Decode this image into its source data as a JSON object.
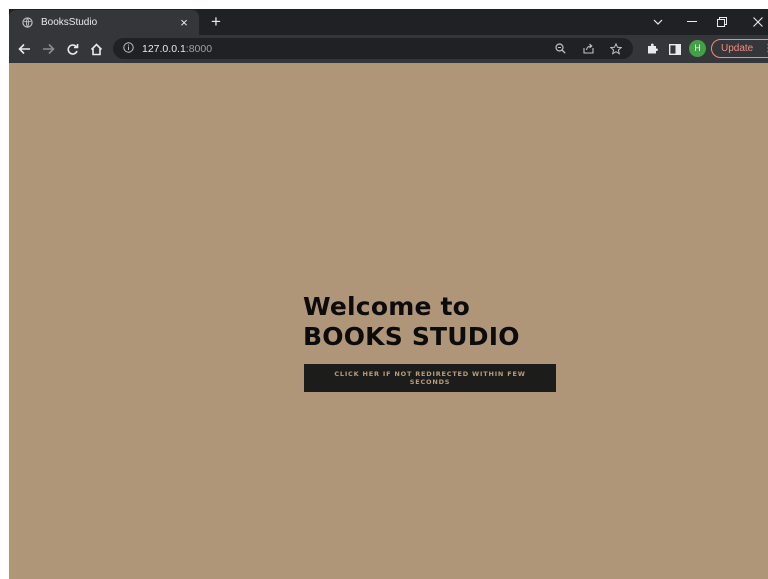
{
  "browser": {
    "tab": {
      "title": "BooksStudio",
      "close": "×"
    },
    "new_tab": "+",
    "window_controls": {
      "tab_search": "⌵",
      "minimize": "—",
      "restore": "❐",
      "close": "✕"
    },
    "address": {
      "host": "127.0.0.1",
      "port": ":8000"
    },
    "profile_initial": "H",
    "update_label": "Update",
    "update_menu": "⋮",
    "icons": [
      "back-arrow-icon",
      "forward-arrow-icon",
      "reload-icon",
      "home-icon",
      "info-icon",
      "zoom-icon",
      "share-icon",
      "star-icon",
      "extensions-icon",
      "side-panel-icon"
    ]
  },
  "page": {
    "heading_line1": "Welcome to",
    "heading_line2": "BOOKS STUDIO",
    "redirect_button": "CLICK HER IF NOT REDIRECTED WITHIN FEW SECONDS"
  },
  "colors": {
    "page_background": "#af9679",
    "button_background": "#1c1c1b",
    "button_text": "#b89d7f",
    "heading_text": "#0c0c0c"
  }
}
